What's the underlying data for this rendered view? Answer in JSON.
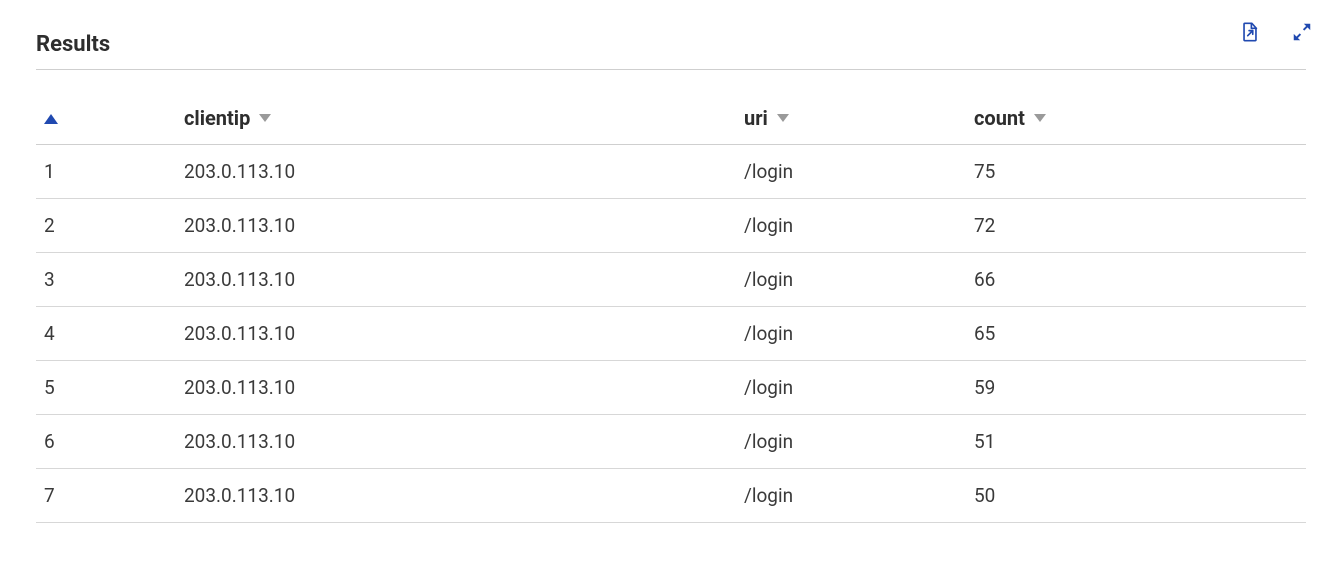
{
  "header": {
    "title": "Results"
  },
  "table": {
    "columns": {
      "index": "",
      "clientip": "clientip",
      "uri": "uri",
      "count": "count"
    },
    "rows": [
      {
        "index": "1",
        "clientip": "203.0.113.10",
        "uri": "/login",
        "count": "75"
      },
      {
        "index": "2",
        "clientip": "203.0.113.10",
        "uri": "/login",
        "count": "72"
      },
      {
        "index": "3",
        "clientip": "203.0.113.10",
        "uri": "/login",
        "count": "66"
      },
      {
        "index": "4",
        "clientip": "203.0.113.10",
        "uri": "/login",
        "count": "65"
      },
      {
        "index": "5",
        "clientip": "203.0.113.10",
        "uri": "/login",
        "count": "59"
      },
      {
        "index": "6",
        "clientip": "203.0.113.10",
        "uri": "/login",
        "count": "51"
      },
      {
        "index": "7",
        "clientip": "203.0.113.10",
        "uri": "/login",
        "count": "50"
      }
    ]
  }
}
